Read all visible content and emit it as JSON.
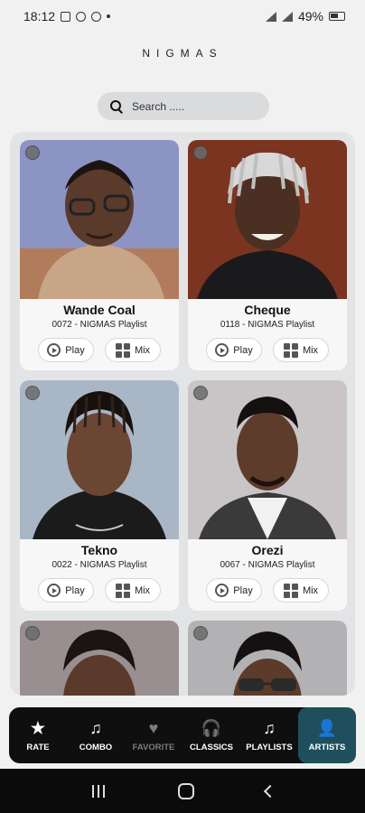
{
  "status_bar": {
    "time": "18:12",
    "battery": "49%"
  },
  "app": {
    "title": "NIGMAS"
  },
  "search": {
    "placeholder": "Search ....."
  },
  "buttons": {
    "play": "Play",
    "mix": "Mix"
  },
  "artists": [
    {
      "name": "Wande Coal",
      "subtitle": "0072 - NIGMAS Playlist",
      "bg": "#8c94c4",
      "shirt": "#c9a587",
      "skin": "#5a3a2a"
    },
    {
      "name": "Cheque",
      "subtitle": "0118 - NIGMAS Playlist",
      "bg": "#7a3420",
      "shirt": "#1a1a1d",
      "skin": "#4b2f22"
    },
    {
      "name": "Tekno",
      "subtitle": "0022 - NIGMAS Playlist",
      "bg": "#a9b6c6",
      "shirt": "#1b1b1b",
      "skin": "#6b4633"
    },
    {
      "name": "Orezi",
      "subtitle": "0067 - NIGMAS Playlist",
      "bg": "#c9c4c6",
      "shirt": "#3a3a3a",
      "skin": "#5e3c2b"
    },
    {
      "name": "",
      "subtitle": "",
      "bg": "#9a8f90",
      "shirt": "#2b2b2b",
      "skin": "#5a3a2b"
    },
    {
      "name": "",
      "subtitle": "",
      "bg": "#b2b2b4",
      "shirt": "#444",
      "skin": "#5c3b29"
    }
  ],
  "nav": [
    {
      "label": "RATE",
      "icon": "star-icon",
      "glyph": "★",
      "state": "normal"
    },
    {
      "label": "COMBO",
      "icon": "music-note-icon",
      "glyph": "♫",
      "state": "normal"
    },
    {
      "label": "FAVORITE",
      "icon": "heart-icon",
      "glyph": "♥",
      "state": "dim"
    },
    {
      "label": "CLASSICS",
      "icon": "headphones-icon",
      "glyph": "🎧",
      "state": "normal"
    },
    {
      "label": "PLAYLISTS",
      "icon": "music-note-icon",
      "glyph": "♫",
      "state": "normal"
    },
    {
      "label": "ARTISTS",
      "icon": "person-icon",
      "glyph": "👤",
      "state": "active"
    }
  ]
}
